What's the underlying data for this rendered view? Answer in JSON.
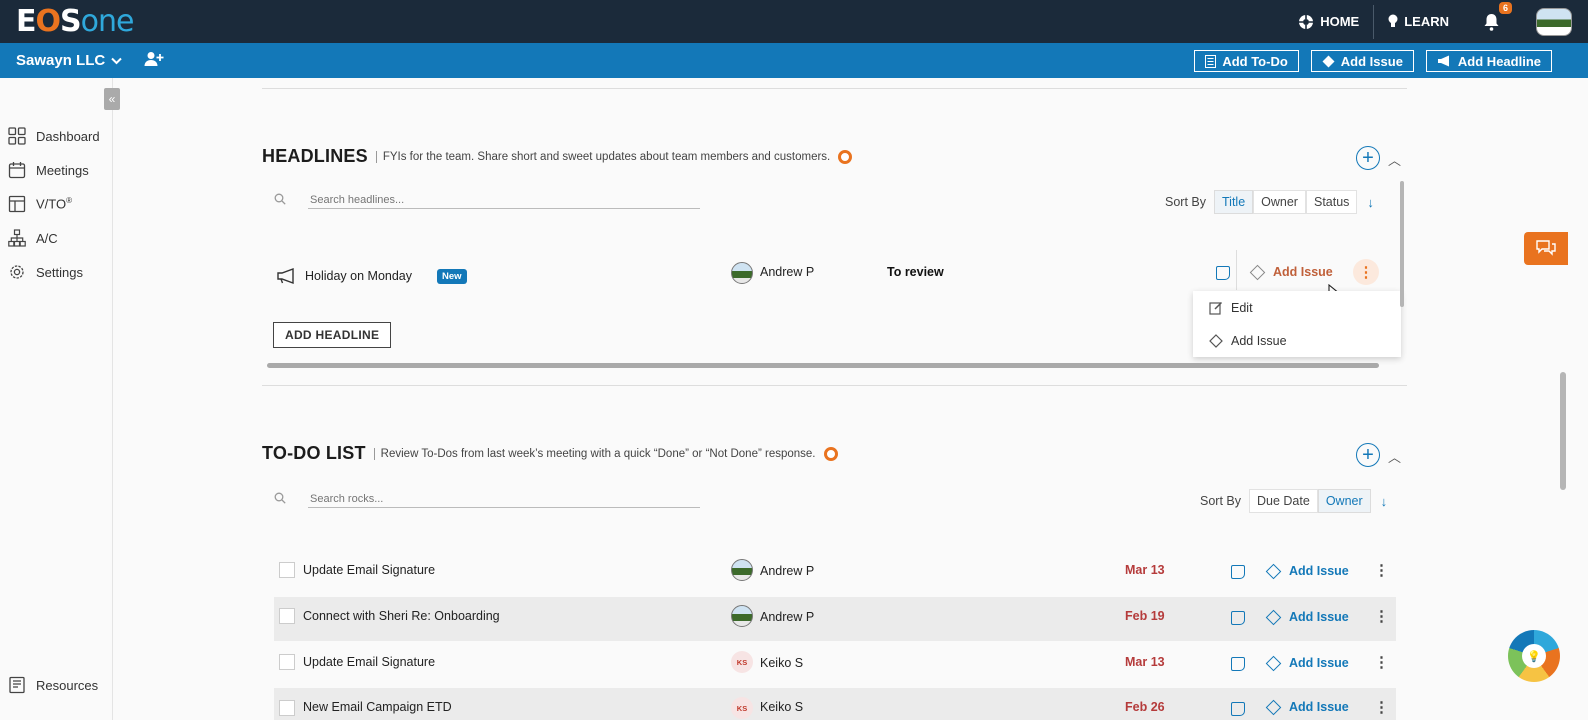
{
  "topbar": {
    "logo": {
      "e": "E",
      "o": "O",
      "s": "S",
      "one": "one"
    },
    "home_label": "HOME",
    "learn_label": "LEARN",
    "notification_count": "6"
  },
  "orgbar": {
    "org_name": "Sawayn LLC",
    "add_todo_label": "Add To-Do",
    "add_issue_label": "Add Issue",
    "add_headline_label": "Add Headline"
  },
  "sidebar": {
    "items": [
      {
        "label": "Dashboard",
        "icon": "grid-icon"
      },
      {
        "label": "Meetings",
        "icon": "calendar-icon"
      },
      {
        "label": "V/TO",
        "sup": "®",
        "icon": "layout-icon"
      },
      {
        "label": "A/C",
        "icon": "org-chart-icon"
      },
      {
        "label": "Settings",
        "icon": "gear-icon"
      }
    ],
    "resources_label": "Resources"
  },
  "headlines": {
    "title": "HEADLINES",
    "subtitle": "FYIs for the team. Share short and sweet updates about team members and customers.",
    "search_placeholder": "Search headlines...",
    "sort_label": "Sort By",
    "sort_options": [
      "Title",
      "Owner",
      "Status"
    ],
    "sort_active": "Title",
    "rows": [
      {
        "title": "Holiday on Monday",
        "badge": "New",
        "owner": "Andrew P",
        "status": "To review",
        "issue_label": "Add Issue"
      }
    ],
    "add_button": "ADD HEADLINE",
    "menu": [
      {
        "label": "Edit",
        "icon": "pencil-icon"
      },
      {
        "label": "Add Issue",
        "icon": "diamond-icon"
      }
    ]
  },
  "todos": {
    "title": "TO-DO LIST",
    "subtitle": "Review To-Dos from last week’s meeting with a quick “Done” or “Not Done” response.",
    "search_placeholder": "Search rocks...",
    "sort_label": "Sort By",
    "sort_options": [
      "Due Date",
      "Owner"
    ],
    "sort_active": "Owner",
    "rows": [
      {
        "title": "Update Email Signature",
        "owner": "Andrew P",
        "initials": "",
        "due": "Mar 13",
        "issue_label": "Add Issue"
      },
      {
        "title": "Connect with Sheri Re: Onboarding",
        "owner": "Andrew P",
        "initials": "",
        "due": "Feb 19",
        "issue_label": "Add Issue"
      },
      {
        "title": "Update Email Signature",
        "owner": "Keiko S",
        "initials": "KS",
        "due": "Mar 13",
        "issue_label": "Add Issue"
      },
      {
        "title": "New Email Campaign ETD",
        "owner": "Keiko S",
        "initials": "KS",
        "due": "Feb 26",
        "issue_label": "Add Issue"
      }
    ]
  },
  "colors": {
    "navy": "#1b2a3a",
    "blue": "#1378b8",
    "orange": "#e9731f",
    "due_red": "#b53b3b"
  }
}
